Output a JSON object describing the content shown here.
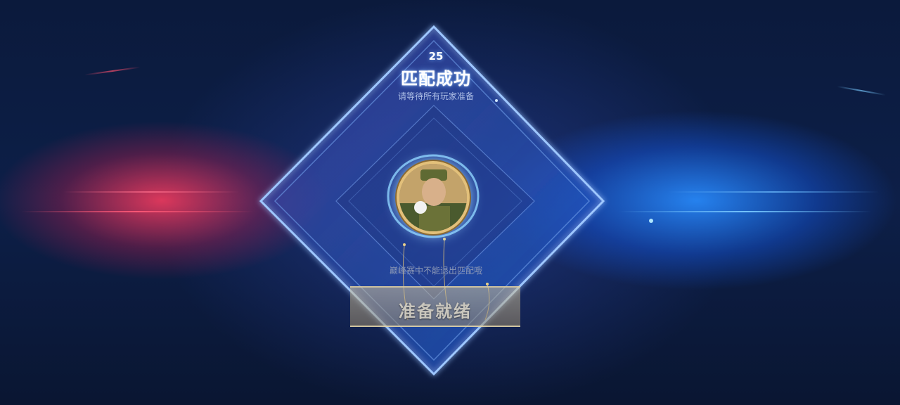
{
  "match": {
    "countdown": "25",
    "title": "匹配成功",
    "subtitle": "请等待所有玩家准备"
  },
  "player": {
    "avatar_icon": "player-avatar"
  },
  "footer": {
    "notice": "巅峰赛中不能退出匹配哦",
    "ready_label": "准备就绪"
  },
  "colors": {
    "red_glow": "#ff3c5f",
    "blue_glow": "#288cff",
    "frame_glow": "#7fb6ff",
    "gold_accent": "#e3c07a"
  }
}
